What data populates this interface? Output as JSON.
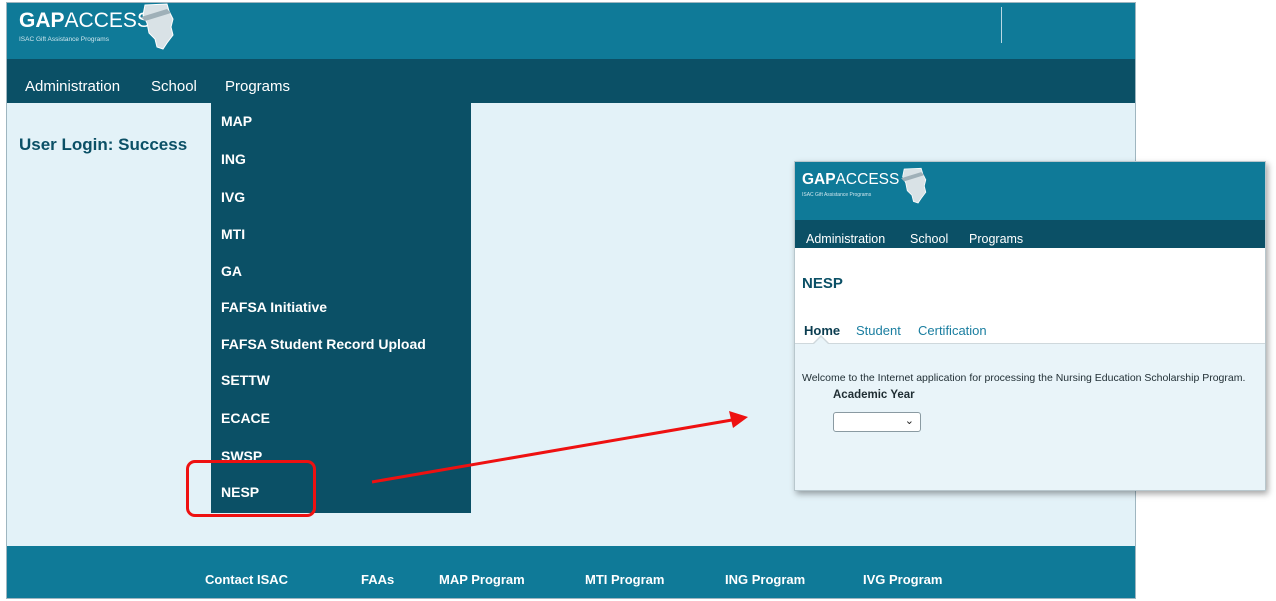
{
  "main": {
    "logo": {
      "brand_bold": "GAP",
      "brand_thin": "ACCESS",
      "subtitle": "ISAC Gift Assistance Programs"
    },
    "nav": [
      "Administration",
      "School",
      "Programs"
    ],
    "login_message": "User Login: Success",
    "programs_menu": [
      "MAP",
      "ING",
      "IVG",
      "MTI",
      "GA",
      "FAFSA Initiative",
      "FAFSA Student Record Upload",
      "SETTW",
      "ECACE",
      "SWSP",
      "NESP"
    ],
    "highlighted_item": "NESP",
    "footer_links": [
      "Contact ISAC",
      "FAAs",
      "MAP Program",
      "MTI Program",
      "ING Program",
      "IVG Program"
    ]
  },
  "inset": {
    "logo": {
      "brand_bold": "GAP",
      "brand_thin": "ACCESS",
      "subtitle": "ISAC Gift Assistance Programs"
    },
    "nav": [
      "Administration",
      "School",
      "Programs"
    ],
    "page_title": "NESP",
    "tabs": [
      "Home",
      "Student",
      "Certification"
    ],
    "active_tab": "Home",
    "welcome_text": "Welcome to the Internet application for processing the Nursing Education Scholarship Program.",
    "academic_year_label": "Academic Year",
    "academic_year_value": ""
  },
  "colors": {
    "header_blue": "#0f7a98",
    "nav_dark": "#0b5066",
    "content_bg": "#e3f2f8",
    "highlight_red": "#ee1111"
  }
}
